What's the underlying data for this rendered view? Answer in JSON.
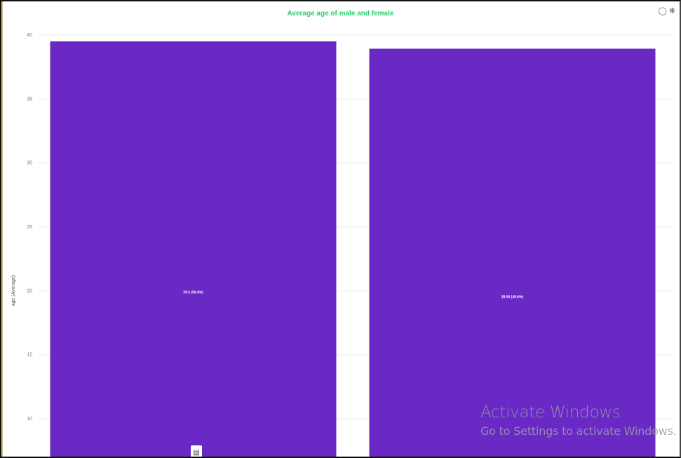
{
  "chart_data": {
    "type": "bar",
    "title": "Average age of male and female",
    "ylabel": "age (Average)",
    "xlabel": "",
    "ylim": [
      7,
      40
    ],
    "yticks": [
      10,
      15,
      20,
      25,
      30,
      35,
      40
    ],
    "grid": true,
    "categories": [
      "",
      ""
    ],
    "values": [
      39.5,
      38.93
    ],
    "data_labels": [
      "39.5 (50.4%)",
      "38.93 (49.6%)"
    ],
    "bar_color": "#6a28c4"
  },
  "toolbar": {
    "pin_icon": "pin-icon",
    "settings_icon": "settings-icon"
  },
  "watermark": {
    "line1": "Activate Windows",
    "line2": "Go to Settings to activate Windows."
  },
  "colors": {
    "title": "#2ecc71",
    "bar": "#6a28c4"
  }
}
